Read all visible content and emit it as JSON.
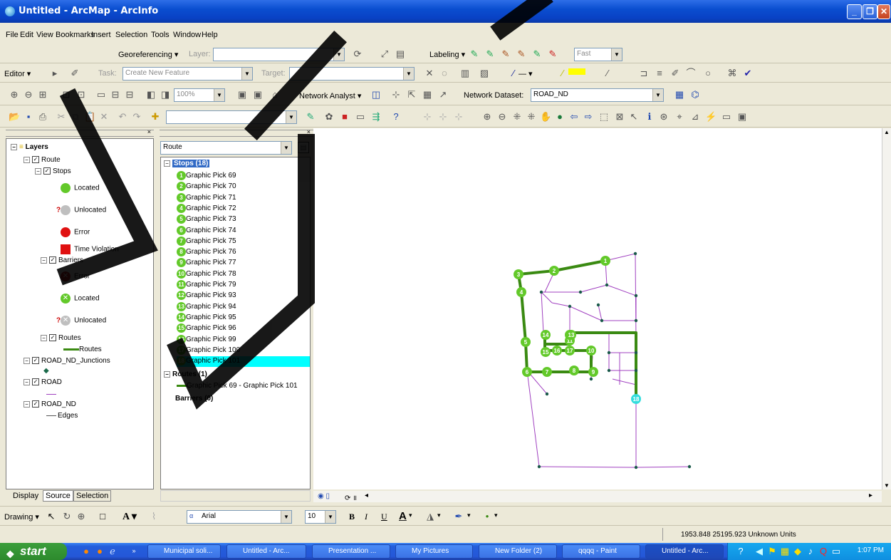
{
  "window": {
    "title": "Untitled - ArcMap - ArcInfo"
  },
  "menu": [
    "File",
    "Edit",
    "View",
    "Bookmarks",
    "Insert",
    "Selection",
    "Tools",
    "Window",
    "Help"
  ],
  "toolbars": {
    "georeferencing": {
      "label": "Georeferencing ▾",
      "layer_label": "Layer:",
      "layer_value": ""
    },
    "labeling": {
      "label": "Labeling ▾",
      "speed": "Fast"
    },
    "editor": {
      "label": "Editor ▾",
      "task_label": "Task:",
      "task_value": "Create New Feature",
      "target_label": "Target:",
      "target_value": ""
    },
    "network": {
      "label": "Network Analyst ▾",
      "dataset_label": "Network Dataset:",
      "dataset_value": "ROAD_ND",
      "zoom": "100%"
    },
    "drawing": {
      "label": "Drawing ▾",
      "font": "Arial",
      "size": "10",
      "bold": "B",
      "italic": "I",
      "underline": "U",
      "fontcolor": "A"
    }
  },
  "toc": {
    "tabs": [
      "Display",
      "Source",
      "Selection"
    ],
    "items": [
      {
        "label": "Layers"
      },
      {
        "label": "Route"
      },
      {
        "label": "Stops"
      },
      {
        "label": "Located"
      },
      {
        "label": "Unlocated"
      },
      {
        "label": "Error"
      },
      {
        "label": "Time Violation"
      },
      {
        "label": "Barriers"
      },
      {
        "label": "Error"
      },
      {
        "label": "Located"
      },
      {
        "label": "Unlocated"
      },
      {
        "label": "Routes"
      },
      {
        "label": "Routes"
      },
      {
        "label": "ROAD_ND_Junctions"
      },
      {
        "label": "ROAD"
      },
      {
        "label": "ROAD_ND"
      },
      {
        "label": "Edges"
      }
    ]
  },
  "na_window": {
    "dropdown": "Route",
    "stops_header": "Stops (18)",
    "stops": [
      {
        "n": "1",
        "label": "Graphic Pick 69"
      },
      {
        "n": "2",
        "label": "Graphic Pick 70"
      },
      {
        "n": "3",
        "label": "Graphic Pick 71"
      },
      {
        "n": "4",
        "label": "Graphic Pick 72"
      },
      {
        "n": "5",
        "label": "Graphic Pick 73"
      },
      {
        "n": "6",
        "label": "Graphic Pick 74"
      },
      {
        "n": "7",
        "label": "Graphic Pick 75"
      },
      {
        "n": "8",
        "label": "Graphic Pick 76"
      },
      {
        "n": "9",
        "label": "Graphic Pick 77"
      },
      {
        "n": "10",
        "label": "Graphic Pick 78"
      },
      {
        "n": "11",
        "label": "Graphic Pick 79"
      },
      {
        "n": "12",
        "label": "Graphic Pick 93"
      },
      {
        "n": "13",
        "label": "Graphic Pick 94"
      },
      {
        "n": "14",
        "label": "Graphic Pick 95"
      },
      {
        "n": "15",
        "label": "Graphic Pick 96"
      },
      {
        "n": "16",
        "label": "Graphic Pick 99"
      },
      {
        "n": "17",
        "label": "Graphic Pick 100"
      },
      {
        "n": "18",
        "label": "Graphic Pick 101"
      }
    ],
    "routes_header": "Routes (1)",
    "route_item": "Graphic Pick 69 - Graphic Pick 101",
    "barriers_header": "Barriers (0)"
  },
  "map": {
    "stop_labels": [
      "1",
      "2",
      "3",
      "4",
      "5",
      "6",
      "7",
      "8",
      "9",
      "10",
      "11",
      "12",
      "13",
      "14",
      "15",
      "16",
      "17",
      "18"
    ],
    "colors": {
      "route": "#3a8a12",
      "road": "#a040c0",
      "stop": "#63c92a",
      "selected_stop": "#33dddd"
    }
  },
  "status": {
    "coords": "1953.848  25195.923 Unknown Units"
  },
  "taskbar": {
    "start": "start",
    "tasks": [
      "Municipal soli...",
      "Untitled - Arc...",
      "Presentation ...",
      "My Pictures",
      "New Folder (2)",
      "qqqq - Paint",
      "Untitled - Arc..."
    ],
    "clock": "1:07 PM"
  }
}
